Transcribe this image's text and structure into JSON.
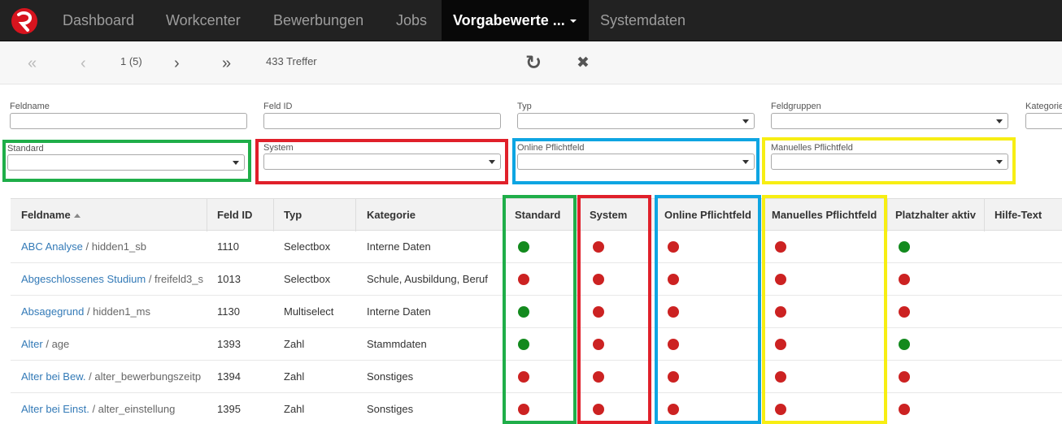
{
  "navbar": {
    "items": [
      "Dashboard",
      "Workcenter",
      "Bewerbungen",
      "Jobs"
    ],
    "active": "Vorgabewerte ...",
    "after": "Systemdaten"
  },
  "toolbar": {
    "first_icon": "«",
    "prev_icon": "‹",
    "page": "1 (5)",
    "next_icon": "›",
    "last_icon": "»",
    "hits": "433 Treffer",
    "refresh_icon": "↻",
    "close_icon": "✖"
  },
  "filters": {
    "feldname": "Feldname",
    "feld_id": "Feld ID",
    "typ": "Typ",
    "feldgruppen": "Feldgruppen",
    "kategorie": "Kategorie",
    "standard": "Standard",
    "system": "System",
    "online": "Online Pflichtfeld",
    "manuell": "Manuelles Pflichtfeld"
  },
  "table": {
    "headers": [
      "Feldname",
      "Feld ID",
      "Typ",
      "Kategorie",
      "Standard",
      "System",
      "Online Pflichtfeld",
      "Manuelles Pflichtfeld",
      "Platzhalter aktiv",
      "Hilfe-Text"
    ],
    "rows": [
      {
        "name": "ABC Analyse",
        "key": " / hidden1_sb",
        "id": "1110",
        "typ": "Selectbox",
        "kategorie": "Interne Daten",
        "standard": true,
        "system": false,
        "online": false,
        "manuell": false,
        "platzhalter": true
      },
      {
        "name": "Abgeschlossenes Studium",
        "key": " / freifeld3_s",
        "id": "1013",
        "typ": "Selectbox",
        "kategorie": "Schule, Ausbildung, Beruf",
        "standard": false,
        "system": false,
        "online": false,
        "manuell": false,
        "platzhalter": false
      },
      {
        "name": "Absagegrund",
        "key": " / hidden1_ms",
        "id": "1130",
        "typ": "Multiselect",
        "kategorie": "Interne Daten",
        "standard": true,
        "system": false,
        "online": false,
        "manuell": false,
        "platzhalter": false
      },
      {
        "name": "Alter",
        "key": " / age",
        "id": "1393",
        "typ": "Zahl",
        "kategorie": "Stammdaten",
        "standard": true,
        "system": false,
        "online": false,
        "manuell": false,
        "platzhalter": true
      },
      {
        "name": "Alter bei Bew.",
        "key": " / alter_bewerbungszeitp",
        "id": "1394",
        "typ": "Zahl",
        "kategorie": "Sonstiges",
        "standard": false,
        "system": false,
        "online": false,
        "manuell": false,
        "platzhalter": false
      },
      {
        "name": "Alter bei Einst.",
        "key": " / alter_einstellung",
        "id": "1395",
        "typ": "Zahl",
        "kategorie": "Sonstiges",
        "standard": false,
        "system": false,
        "online": false,
        "manuell": false,
        "platzhalter": false
      }
    ]
  },
  "colors": {
    "status_true": "#138a1e",
    "status_false": "#cc2222",
    "highlight_green": "#1fae49",
    "highlight_red": "#e0202a",
    "highlight_blue": "#0ea5e2",
    "highlight_yellow": "#f7ee13"
  }
}
